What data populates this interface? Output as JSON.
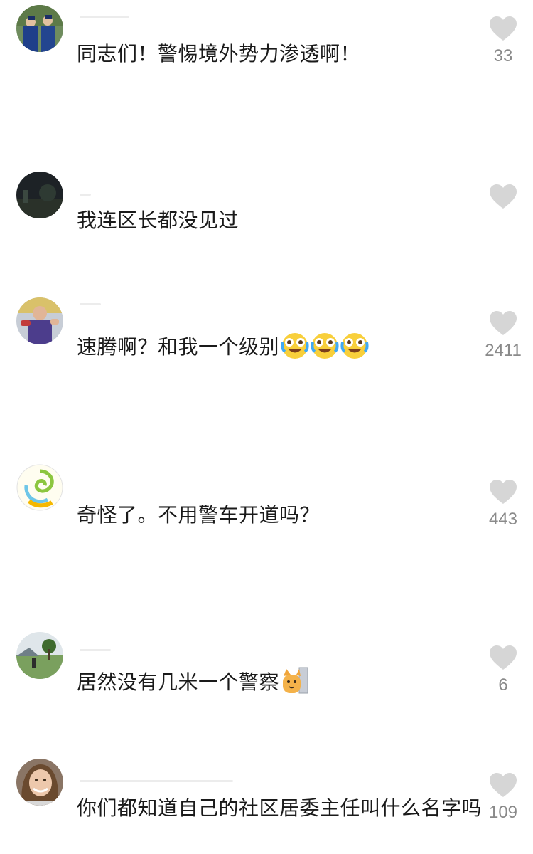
{
  "comments": [
    {
      "avatar": "avatar-police-group",
      "text": "同志们！警惕境外势力渗透啊！",
      "likes": "33"
    },
    {
      "avatar": "avatar-dark-scene",
      "text": "我连区长都没见过",
      "likes": ""
    },
    {
      "avatar": "avatar-person-gesture",
      "text": "速腾啊？和我一个级别",
      "emojis": [
        "laugh-cry-emoji",
        "laugh-cry-emoji",
        "laugh-cry-emoji"
      ],
      "likes": "2411"
    },
    {
      "avatar": "avatar-swirl",
      "text": "奇怪了。不用警车开道吗？",
      "likes": "443"
    },
    {
      "avatar": "avatar-landscape",
      "text": "居然没有几米一个警察",
      "emojis": [
        "peeking-cat-emoji"
      ],
      "likes": "6"
    },
    {
      "avatar": "avatar-woman-smiling",
      "text": "你们都知道自己的社区居委主任叫什么名字吗",
      "likes": "109"
    }
  ],
  "colors": {
    "like_icon": "#d6d6d6",
    "count_text": "#8a8a8a"
  }
}
